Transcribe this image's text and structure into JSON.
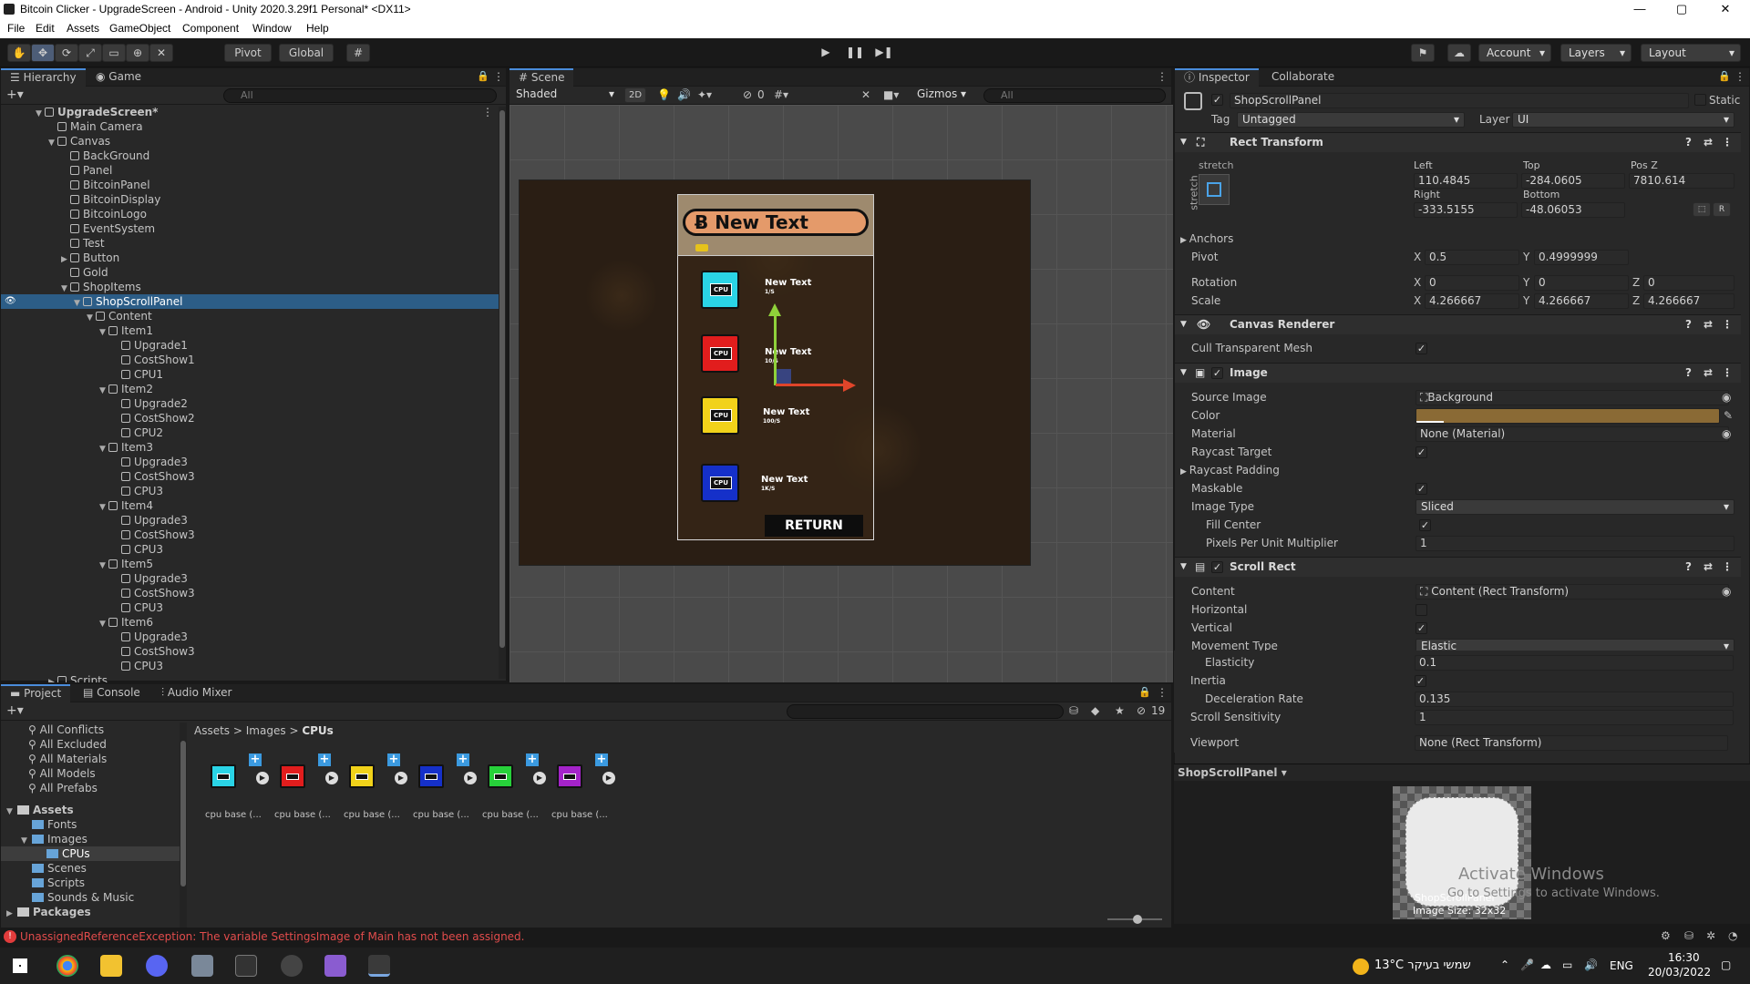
{
  "window": {
    "title": "Bitcoin Clicker - UpgradeScreen - Android - Unity 2020.3.29f1 Personal* <DX11>",
    "min": "—",
    "max": "▢",
    "close": "✕"
  },
  "menu": [
    "File",
    "Edit",
    "Assets",
    "GameObject",
    "Component",
    "Window",
    "Help"
  ],
  "toolbar": {
    "pivot": "Pivot",
    "global": "Global",
    "account": "Account",
    "layers": "Layers",
    "layout": "Layout"
  },
  "hierarchy": {
    "tabs": [
      "Hierarchy",
      "Game"
    ],
    "search_placeholder": "All",
    "rows": [
      {
        "label": "UpgradeScreen*",
        "indent": 0,
        "arrow": "▼",
        "bold": true,
        "scene": true
      },
      {
        "label": "Main Camera",
        "indent": 1,
        "arrow": ""
      },
      {
        "label": "Canvas",
        "indent": 1,
        "arrow": "▼"
      },
      {
        "label": "BackGround",
        "indent": 2,
        "arrow": ""
      },
      {
        "label": "Panel",
        "indent": 2,
        "arrow": ""
      },
      {
        "label": "BitcoinPanel",
        "indent": 2,
        "arrow": ""
      },
      {
        "label": "BitcoinDisplay",
        "indent": 2,
        "arrow": ""
      },
      {
        "label": "BitcoinLogo",
        "indent": 2,
        "arrow": ""
      },
      {
        "label": "EventSystem",
        "indent": 2,
        "arrow": ""
      },
      {
        "label": "Test",
        "indent": 2,
        "arrow": ""
      },
      {
        "label": "Button",
        "indent": 2,
        "arrow": "▶"
      },
      {
        "label": "Gold",
        "indent": 2,
        "arrow": ""
      },
      {
        "label": "ShopItems",
        "indent": 2,
        "arrow": "▼"
      },
      {
        "label": "ShopScrollPanel",
        "indent": 3,
        "arrow": "▼",
        "selected": true
      },
      {
        "label": "Content",
        "indent": 4,
        "arrow": "▼"
      },
      {
        "label": "Item1",
        "indent": 5,
        "arrow": "▼"
      },
      {
        "label": "Upgrade1",
        "indent": 6,
        "arrow": ""
      },
      {
        "label": "CostShow1",
        "indent": 6,
        "arrow": ""
      },
      {
        "label": "CPU1",
        "indent": 6,
        "arrow": ""
      },
      {
        "label": "Item2",
        "indent": 5,
        "arrow": "▼"
      },
      {
        "label": "Upgrade2",
        "indent": 6,
        "arrow": ""
      },
      {
        "label": "CostShow2",
        "indent": 6,
        "arrow": ""
      },
      {
        "label": "CPU2",
        "indent": 6,
        "arrow": ""
      },
      {
        "label": "Item3",
        "indent": 5,
        "arrow": "▼"
      },
      {
        "label": "Upgrade3",
        "indent": 6,
        "arrow": ""
      },
      {
        "label": "CostShow3",
        "indent": 6,
        "arrow": ""
      },
      {
        "label": "CPU3",
        "indent": 6,
        "arrow": ""
      },
      {
        "label": "Item4",
        "indent": 5,
        "arrow": "▼"
      },
      {
        "label": "Upgrade3",
        "indent": 6,
        "arrow": ""
      },
      {
        "label": "CostShow3",
        "indent": 6,
        "arrow": ""
      },
      {
        "label": "CPU3",
        "indent": 6,
        "arrow": ""
      },
      {
        "label": "Item5",
        "indent": 5,
        "arrow": "▼"
      },
      {
        "label": "Upgrade3",
        "indent": 6,
        "arrow": ""
      },
      {
        "label": "CostShow3",
        "indent": 6,
        "arrow": ""
      },
      {
        "label": "CPU3",
        "indent": 6,
        "arrow": ""
      },
      {
        "label": "Item6",
        "indent": 5,
        "arrow": "▼"
      },
      {
        "label": "Upgrade3",
        "indent": 6,
        "arrow": ""
      },
      {
        "label": "CostShow3",
        "indent": 6,
        "arrow": ""
      },
      {
        "label": "CPU3",
        "indent": 6,
        "arrow": ""
      },
      {
        "label": "Scripts",
        "indent": 1,
        "arrow": "▶"
      }
    ]
  },
  "scene": {
    "tab": "Scene",
    "shading": "Shaded",
    "mode2d": "2D",
    "hidden_count": "0",
    "gizmos": "Gizmos",
    "search_placeholder": "All",
    "game": {
      "header": "New Text",
      "items": [
        {
          "title": "New Text",
          "rate": "1/S",
          "color": "#2ad4e6"
        },
        {
          "title": "New Text",
          "rate": "10/S",
          "color": "#e11d1d"
        },
        {
          "title": "New Text",
          "rate": "100/S",
          "color": "#f1d21a"
        },
        {
          "title": "New Text",
          "rate": "1K/S",
          "color": "#1530c9"
        }
      ],
      "cpu_label": "CPU",
      "return": "RETURN"
    }
  },
  "inspector": {
    "tabs": [
      "Inspector",
      "Collaborate"
    ],
    "object_name": "ShopScrollPanel",
    "static": "Static",
    "tag_label": "Tag",
    "tag": "Untagged",
    "layer_label": "Layer",
    "layer": "UI",
    "rect": {
      "title": "Rect Transform",
      "stretch": "stretch",
      "left_l": "Left",
      "left": "110.4845",
      "top_l": "Top",
      "top": "-284.0605",
      "posz_l": "Pos Z",
      "posz": "7810.614",
      "right_l": "Right",
      "right": "-333.5155",
      "bottom_l": "Bottom",
      "bottom": "-48.06053",
      "anchors": "Anchors",
      "pivot": "Pivot",
      "pivot_x": "0.5",
      "pivot_y": "0.4999999",
      "rotation": "Rotation",
      "rot_x": "0",
      "rot_y": "0",
      "rot_z": "0",
      "scale": "Scale",
      "sc_x": "4.266667",
      "sc_y": "4.266667",
      "sc_z": "4.266667",
      "r": "R"
    },
    "canvas_renderer": {
      "title": "Canvas Renderer",
      "cull": "Cull Transparent Mesh"
    },
    "image": {
      "title": "Image",
      "source_l": "Source Image",
      "source": "Background",
      "color_l": "Color",
      "color": "#8a6a35",
      "material_l": "Material",
      "material": "None (Material)",
      "raycast_l": "Raycast Target",
      "raycast_pad": "Raycast Padding",
      "maskable": "Maskable",
      "type_l": "Image Type",
      "type": "Sliced",
      "fill_center": "Fill Center",
      "ppu_l": "Pixels Per Unit Multiplier",
      "ppu": "1"
    },
    "scroll": {
      "title": "Scroll Rect",
      "content_l": "Content",
      "content": "Content (Rect Transform)",
      "horizontal": "Horizontal",
      "vertical": "Vertical",
      "movement_l": "Movement Type",
      "movement": "Elastic",
      "elasticity_l": "Elasticity",
      "elasticity": "0.1",
      "inertia": "Inertia",
      "decel_l": "Deceleration Rate",
      "decel": "0.135",
      "sens_l": "Scroll Sensitivity",
      "sens": "1",
      "viewport_l": "Viewport",
      "viewport": "None (Rect Transform)"
    },
    "preview": {
      "title": "ShopScrollPanel",
      "name": "ShopScrollPanel",
      "size": "Image Size: 32x32",
      "activate1": "Activate Windows",
      "activate2": "Go to Settings to activate Windows."
    }
  },
  "project": {
    "tabs": [
      "Project",
      "Console",
      "Audio Mixer"
    ],
    "hidden_count": "19",
    "favorites": [
      "All Conflicts",
      "All Excluded",
      "All Materials",
      "All Models",
      "All Prefabs"
    ],
    "tree": [
      {
        "label": "Assets",
        "indent": 0,
        "arrow": "▼",
        "bold": true
      },
      {
        "label": "Fonts",
        "indent": 1,
        "arrow": ""
      },
      {
        "label": "Images",
        "indent": 1,
        "arrow": "▼"
      },
      {
        "label": "CPUs",
        "indent": 2,
        "arrow": "",
        "selected": true
      },
      {
        "label": "Scenes",
        "indent": 1,
        "arrow": ""
      },
      {
        "label": "Scripts",
        "indent": 1,
        "arrow": ""
      },
      {
        "label": "Sounds & Music",
        "indent": 1,
        "arrow": ""
      },
      {
        "label": "Packages",
        "indent": 0,
        "arrow": "▶",
        "bold": true
      }
    ],
    "breadcrumb": [
      "Assets",
      "Images",
      "CPUs"
    ],
    "assets": [
      {
        "label": "cpu base (...",
        "color": "#2ad4e6"
      },
      {
        "label": "cpu base (...",
        "color": "#e11d1d"
      },
      {
        "label": "cpu base (...",
        "color": "#f1d21a"
      },
      {
        "label": "cpu base (...",
        "color": "#1530c9"
      },
      {
        "label": "cpu base (...",
        "color": "#27d13a"
      },
      {
        "label": "cpu base (...",
        "color": "#a423c9"
      }
    ]
  },
  "status": {
    "error": "UnassignedReferenceException: The variable SettingsImage of Main has not been assigned."
  },
  "taskbar": {
    "weather": "13°C שמשי בעיקר",
    "lang": "ENG",
    "time": "16:30",
    "date": "20/03/2022"
  }
}
